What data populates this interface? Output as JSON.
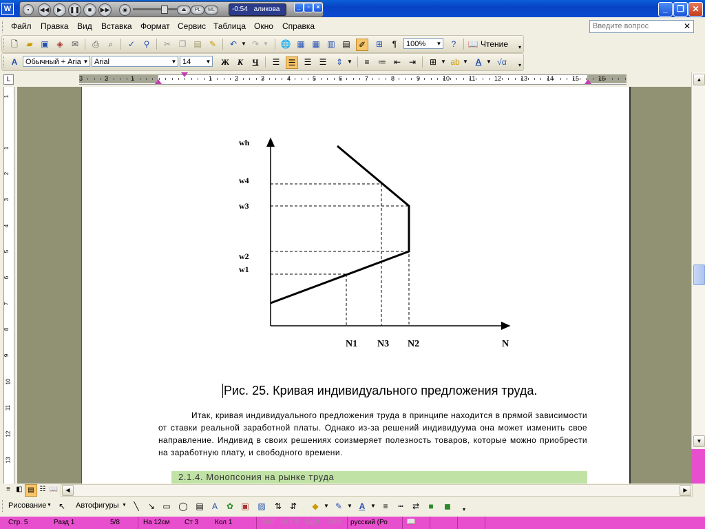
{
  "window": {
    "title_initial": "W"
  },
  "media": {
    "time": "-0:54",
    "track": "аликова"
  },
  "menu": [
    "Файл",
    "Правка",
    "Вид",
    "Вставка",
    "Формат",
    "Сервис",
    "Таблица",
    "Окно",
    "Справка"
  ],
  "ask_placeholder": "Введите вопрос",
  "toolbar": {
    "zoom": "100%",
    "read_label": "Чтение",
    "style": "Обычный + Aria",
    "font": "Arial",
    "size": "14"
  },
  "ruler": {
    "h_labels": [
      "3",
      "2",
      "1",
      "1",
      "2",
      "3",
      "4",
      "5",
      "6",
      "7",
      "8",
      "9",
      "10",
      "11",
      "12",
      "13",
      "14",
      "15",
      "16",
      "17"
    ],
    "v_labels": [
      "1",
      "1",
      "2",
      "3",
      "4",
      "5",
      "6",
      "7",
      "8",
      "9",
      "10",
      "11",
      "12",
      "13"
    ]
  },
  "figure": {
    "w_labels": {
      "wh": "wh",
      "w4": "w4",
      "w3": "w3",
      "w2": "w2",
      "w1": "w1"
    },
    "n_labels": {
      "n1": "N1",
      "n3": "N3",
      "n2": "N2",
      "n": "N"
    }
  },
  "caption": "Рис. 25. Кривая индивидуального предложения труда.",
  "paragraph": "Итак, кривая индивидуального предложения труда  в принципе находится в прямой зависимости от ставки реальной заработной платы. Однако из-за решений индивидуума она может изменить свое направление. Индивид в своих решениях соизмеряет полезность товаров, которые можно приобрести на заработную плату, и свободного времени.",
  "section_heading": "2.1.4. Монопсония на рынке труда",
  "drawing": {
    "draw_label": "Рисование",
    "autoshapes_label": "Автофигуры"
  },
  "status": {
    "page": "Стр. 5",
    "section": "Разд 1",
    "pages": "5/8",
    "at": "На 12см",
    "line": "Ст 3",
    "col": "Кол 1",
    "rec": "ЗАП",
    "trk": "ИСПР",
    "ext": "ВДЛ",
    "ovr": "ЗАМ",
    "lang": "русский (Ро"
  }
}
